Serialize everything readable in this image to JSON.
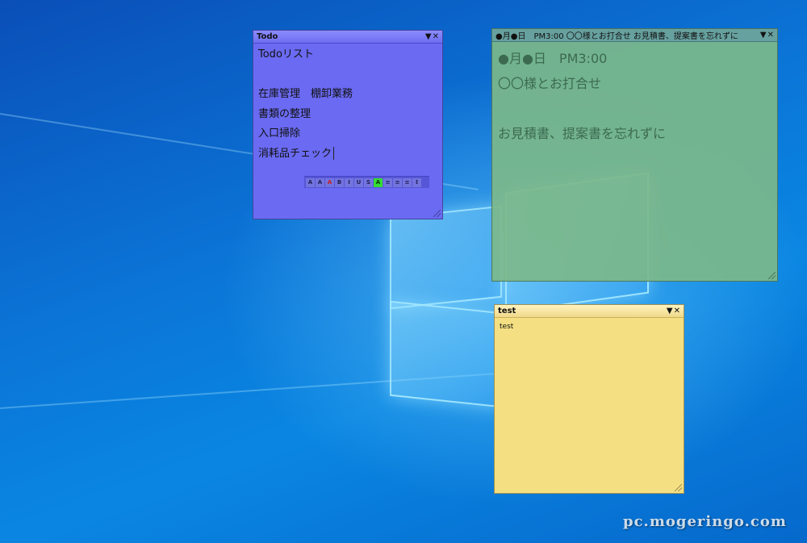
{
  "colors": {
    "todo_note": "#6a6af2",
    "meeting_note": "#7cb88a",
    "test_note": "#f4df82",
    "desktop": "#0a78d8"
  },
  "notes": {
    "todo": {
      "title": "Todo",
      "lines": [
        "Todoリスト",
        "",
        "在庫管理　棚卸業務",
        "書類の整理",
        "入口掃除",
        "消耗品チェック"
      ],
      "toolbar": [
        "A",
        "A",
        "A",
        "B",
        "I",
        "U",
        "S",
        "A",
        "≡",
        "≡",
        "≡",
        "↕"
      ]
    },
    "meeting": {
      "title": "●月●日　PM3:00 〇〇様とお打合せ  お見積書、提案書を忘れずに",
      "lines": [
        "●月●日　PM3:00",
        "〇〇様とお打合せ",
        "",
        "お見積書、提案書を忘れずに"
      ]
    },
    "test": {
      "title": "test",
      "lines": [
        "test"
      ]
    }
  },
  "controls": {
    "menu_glyph": "▼",
    "close_glyph": "✕"
  },
  "watermark": "pc.mogeringo.com"
}
